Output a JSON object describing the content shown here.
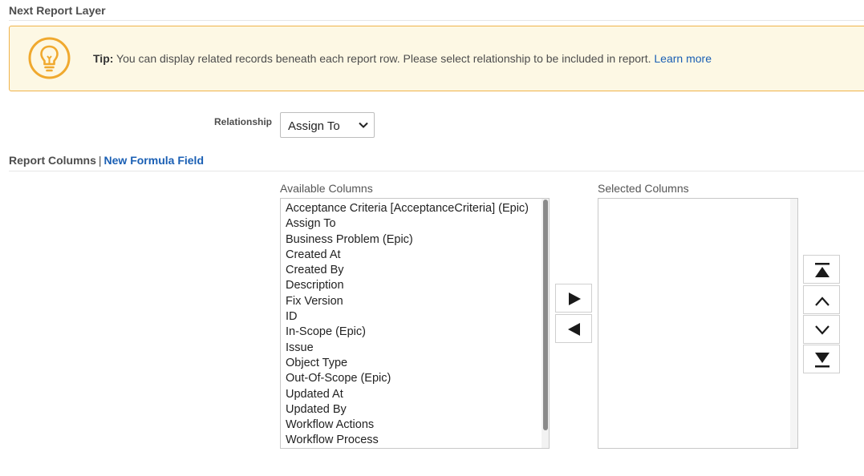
{
  "header": {
    "title": "Next Report Layer"
  },
  "tip": {
    "icon": "lightbulb-icon",
    "prefix": "Tip:",
    "text": "You can display related records beneath each report row. Please select relationship to be included in report.",
    "link": "Learn more",
    "accent_color": "#f0a92e",
    "background": "#fdf8e4"
  },
  "relationship": {
    "label": "Relationship",
    "value": "Assign To"
  },
  "report_columns": {
    "title": "Report Columns",
    "separator": "|",
    "formula_link": "New Formula Field",
    "available_label": "Available Columns",
    "selected_label": "Selected Columns",
    "available": [
      "Acceptance Criteria [AcceptanceCriteria] (Epic)",
      "Assign To",
      "Business Problem (Epic)",
      "Created At",
      "Created By",
      "Description",
      "Fix Version",
      "ID",
      "In-Scope (Epic)",
      "Issue",
      "Object Type",
      "Out-Of-Scope (Epic)",
      "Updated At",
      "Updated By",
      "Workflow Actions",
      "Workflow Process"
    ],
    "selected": []
  },
  "buttons": {
    "move_right": "play-right-icon",
    "move_left": "play-left-icon",
    "move_top": "move-top-icon",
    "move_up": "chevron-up-icon",
    "move_down": "chevron-down-icon",
    "move_bottom": "move-bottom-icon"
  },
  "link_color": "#1a5fb4"
}
